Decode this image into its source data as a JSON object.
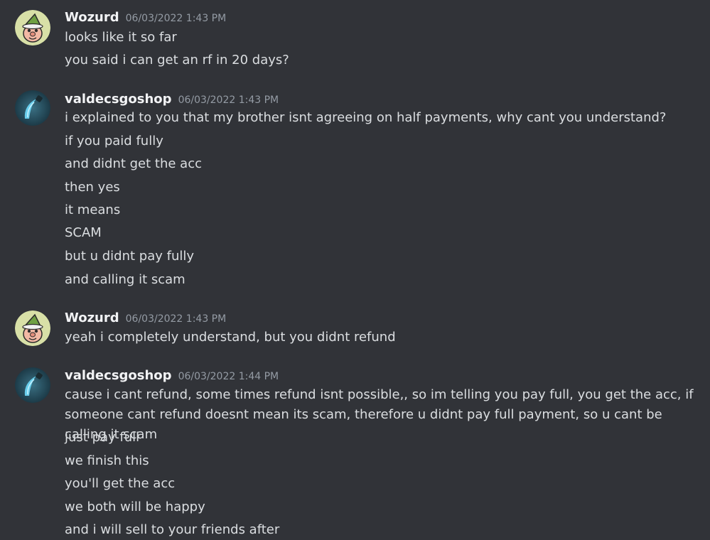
{
  "colors": {
    "background": "#313338",
    "text": "#dbdee1",
    "username": "#f2f3f5",
    "timestamp": "#949ba4"
  },
  "messages": [
    {
      "author": "Wozurd",
      "avatar_icon": "gnome-avatar-icon",
      "timestamp": "06/03/2022 1:43 PM",
      "lines": [
        "looks like it so far",
        "you said i can get an rf in 20 days?"
      ]
    },
    {
      "author": "valdecsgoshop",
      "avatar_icon": "knife-avatar-icon",
      "timestamp": "06/03/2022 1:43 PM",
      "lines": [
        "i explained to you that my brother isnt agreeing on half payments, why cant you understand?",
        "if you paid fully",
        "and didnt get the acc",
        "then yes",
        "it means",
        "SCAM",
        "but u didnt pay fully",
        "and calling it scam"
      ]
    },
    {
      "author": "Wozurd",
      "avatar_icon": "gnome-avatar-icon",
      "timestamp": "06/03/2022 1:43 PM",
      "lines": [
        "yeah i completely understand, but you didnt refund"
      ]
    },
    {
      "author": "valdecsgoshop",
      "avatar_icon": "knife-avatar-icon",
      "timestamp": "06/03/2022 1:44 PM",
      "lines": [
        "cause i cant refund, some times refund isnt possible,, so im telling you pay full, you get the acc, if someone cant refund doesnt mean its scam, therefore u didnt pay full payment, so u cant be calling it scam",
        "just pay full",
        "we finish this",
        "you'll get the acc",
        "we both will be happy",
        "and i will sell to your friends after"
      ]
    }
  ]
}
